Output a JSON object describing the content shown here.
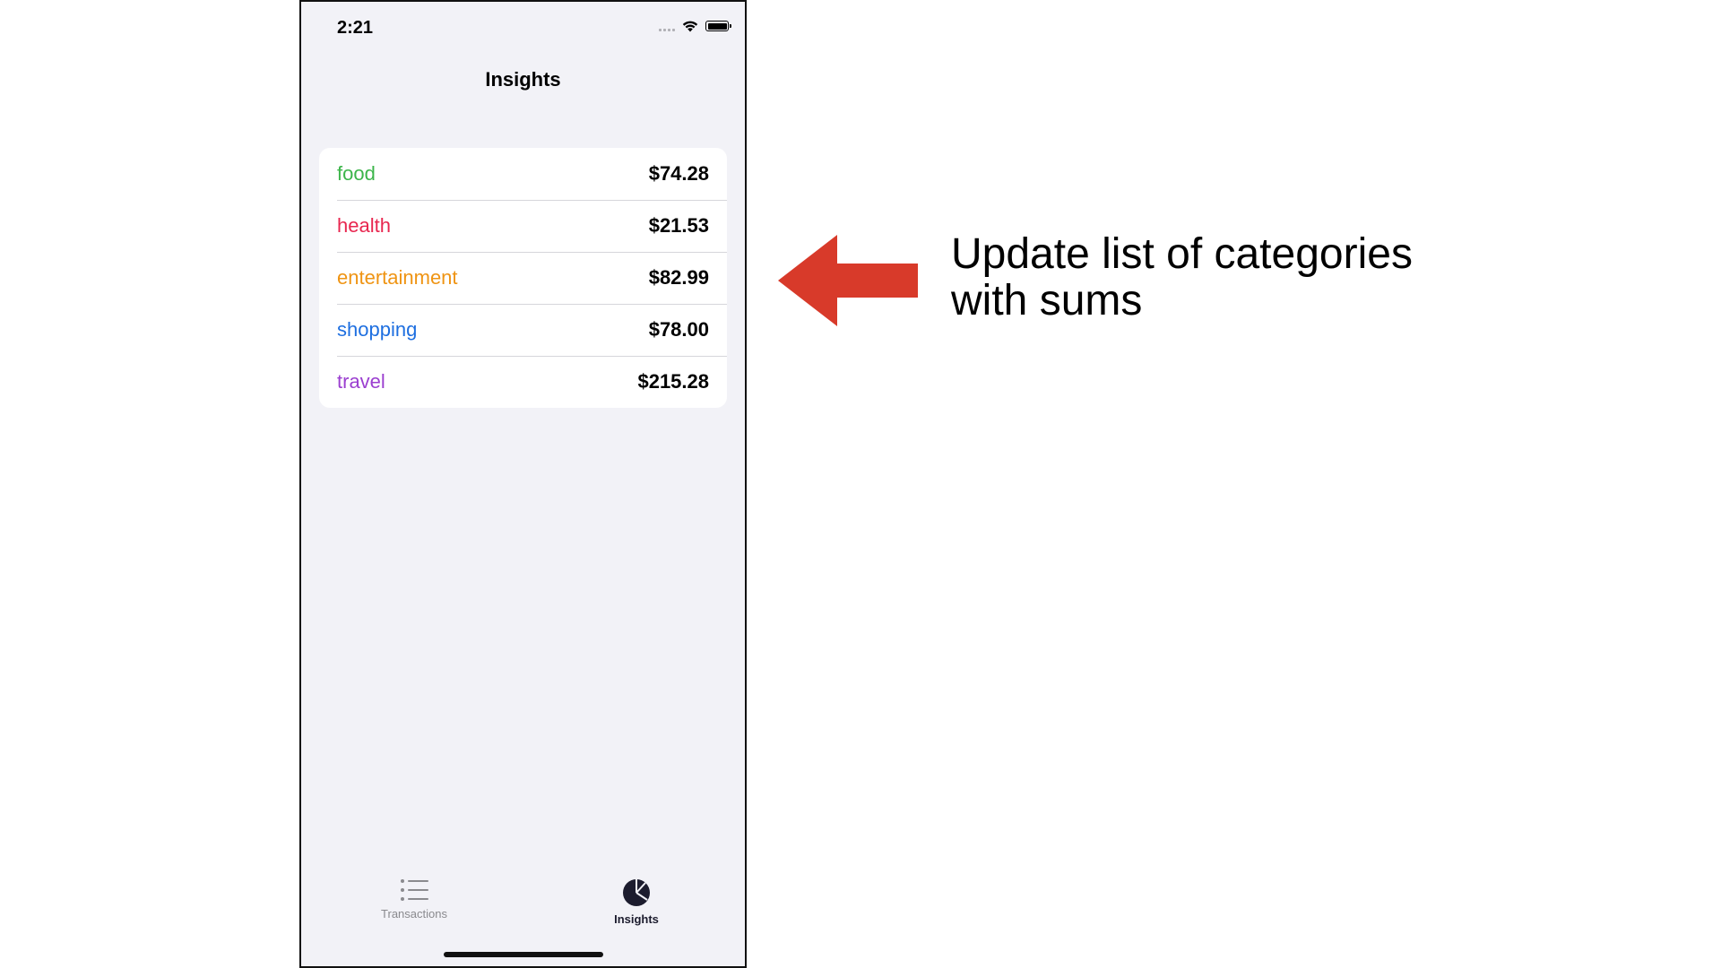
{
  "status_bar": {
    "time": "2:21"
  },
  "nav": {
    "title": "Insights"
  },
  "categories": [
    {
      "name": "food",
      "amount": "$74.28",
      "color": "#3cb54a"
    },
    {
      "name": "health",
      "amount": "$21.53",
      "color": "#e8264f"
    },
    {
      "name": "entertainment",
      "amount": "$82.99",
      "color": "#ef9413"
    },
    {
      "name": "shopping",
      "amount": "$78.00",
      "color": "#1e6fe0"
    },
    {
      "name": "travel",
      "amount": "$215.28",
      "color": "#9b3fd0"
    }
  ],
  "tab_bar": {
    "transactions_label": "Transactions",
    "transactions_icon": "list-icon",
    "insights_label": "Insights",
    "insights_icon": "pie-chart-icon",
    "selected": "Insights"
  },
  "annotation": {
    "text": "Update list of categories\nwith sums",
    "arrow_color": "#d83a2a"
  }
}
